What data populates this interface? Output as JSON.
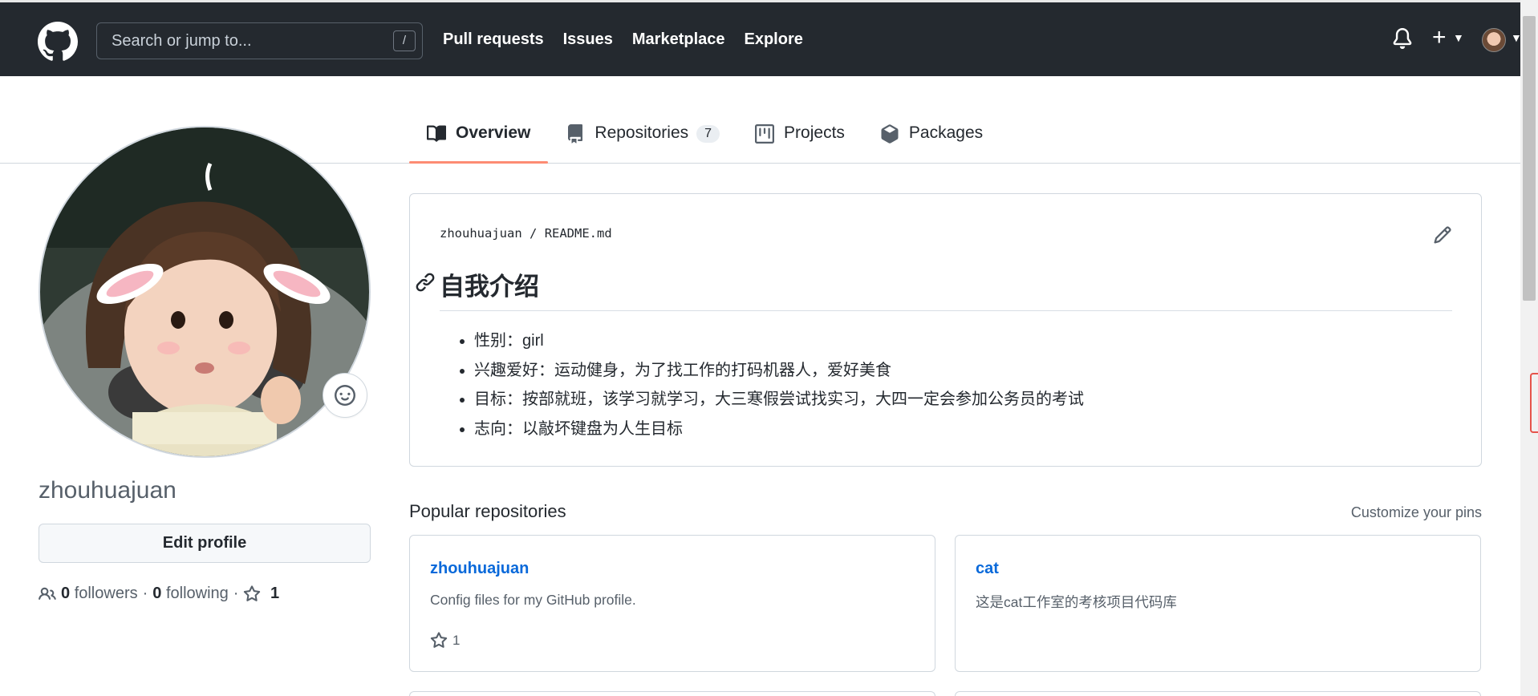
{
  "header": {
    "search_placeholder": "Search or jump to...",
    "search_shortcut": "/",
    "nav": [
      "Pull requests",
      "Issues",
      "Marketplace",
      "Explore"
    ],
    "plus_label": "+"
  },
  "tabs": [
    {
      "label": "Overview",
      "icon": "book-icon",
      "active": true
    },
    {
      "label": "Repositories",
      "icon": "repo-icon",
      "count": "7"
    },
    {
      "label": "Projects",
      "icon": "project-icon"
    },
    {
      "label": "Packages",
      "icon": "package-icon"
    }
  ],
  "profile": {
    "username": "zhouhuajuan",
    "edit_label": "Edit profile",
    "followers_count": "0",
    "followers_label": "followers",
    "following_count": "0",
    "following_label": "following",
    "stars_count": "1",
    "separator": "·"
  },
  "readme": {
    "owner": "zhouhuajuan",
    "slash": "/",
    "file": "README.md",
    "heading": "自我介绍",
    "items": [
      "性别：girl",
      "兴趣爱好：运动健身，为了找工作的打码机器人，爱好美食",
      "目标：按部就班，该学习就学习，大三寒假尝试找实习，大四一定会参加公务员的考试",
      "志向：以敲坏键盘为人生目标"
    ]
  },
  "popular": {
    "title": "Popular repositories",
    "customize_label": "Customize your pins",
    "repos": [
      {
        "name": "zhouhuajuan",
        "description": "Config files for my GitHub profile.",
        "stars": "1"
      },
      {
        "name": "cat",
        "description": "这是cat工作室的考核项目代码库"
      }
    ]
  },
  "colors": {
    "header_bg": "#24292f",
    "tab_underline": "#fd8c73",
    "link": "#0969da"
  }
}
